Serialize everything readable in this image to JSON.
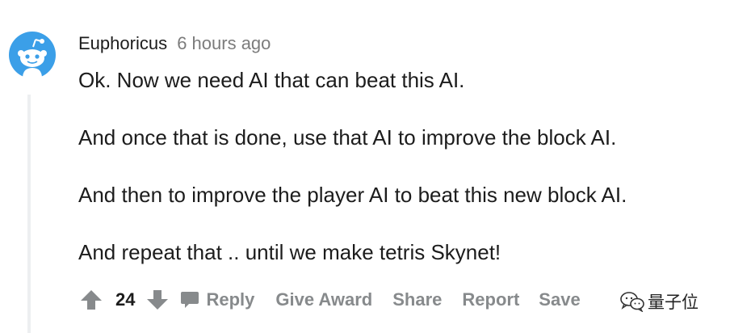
{
  "comment": {
    "author": "Euphoricus",
    "timestamp": "6 hours ago",
    "paragraphs": [
      "Ok. Now we need AI that can beat this AI.",
      "And once that is done, use that AI to improve the block AI.",
      "And then to improve the player AI to beat this new block AI.",
      "And repeat that .. until we make tetris Skynet!"
    ],
    "score": "24"
  },
  "actions": {
    "reply": "Reply",
    "give_award": "Give Award",
    "share": "Share",
    "report": "Report",
    "save": "Save"
  },
  "watermark": {
    "text": "量子位"
  },
  "colors": {
    "avatar_bg": "#3b9fe8",
    "action_gray": "#878a8c",
    "text": "#1c1c1c",
    "meta_gray": "#7c7c7c",
    "thread_line": "#edeff1"
  },
  "icons": {
    "avatar": "snoo-avatar-icon",
    "upvote": "arrow-up-icon",
    "downvote": "arrow-down-icon",
    "reply": "speech-bubble-icon",
    "watermark": "wechat-icon"
  }
}
